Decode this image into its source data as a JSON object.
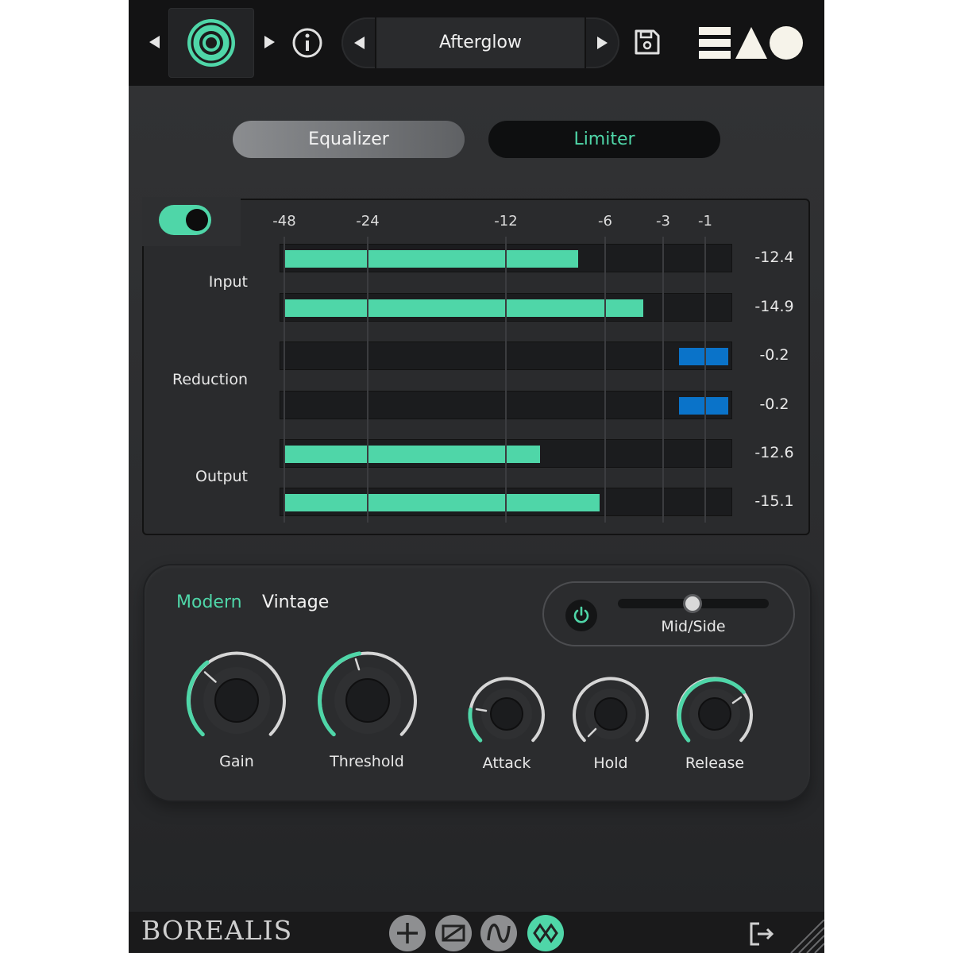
{
  "header": {
    "preset_name": "Afterglow"
  },
  "tabs": {
    "equalizer": "Equalizer",
    "limiter": "Limiter"
  },
  "meters": {
    "scale_labels": [
      "-48",
      "-24",
      "-12",
      "-6",
      "-3",
      "-1"
    ],
    "input_label": "Input",
    "reduction_label": "Reduction",
    "output_label": "Output",
    "values": [
      "-12.4",
      "-14.9",
      "-0.2",
      "-0.2",
      "-12.6",
      "-15.1"
    ]
  },
  "controls": {
    "modes": {
      "modern": "Modern",
      "vintage": "Vintage"
    },
    "mid_side_label": "Mid/Side",
    "knobs": {
      "gain": "Gain",
      "threshold": "Threshold",
      "attack": "Attack",
      "hold": "Hold",
      "release": "Release"
    }
  },
  "footer": {
    "brand": "BOREALIS"
  },
  "colors": {
    "accent": "#4fd6a8",
    "reduction": "#0a73c9",
    "background": "#2b2c2e"
  }
}
